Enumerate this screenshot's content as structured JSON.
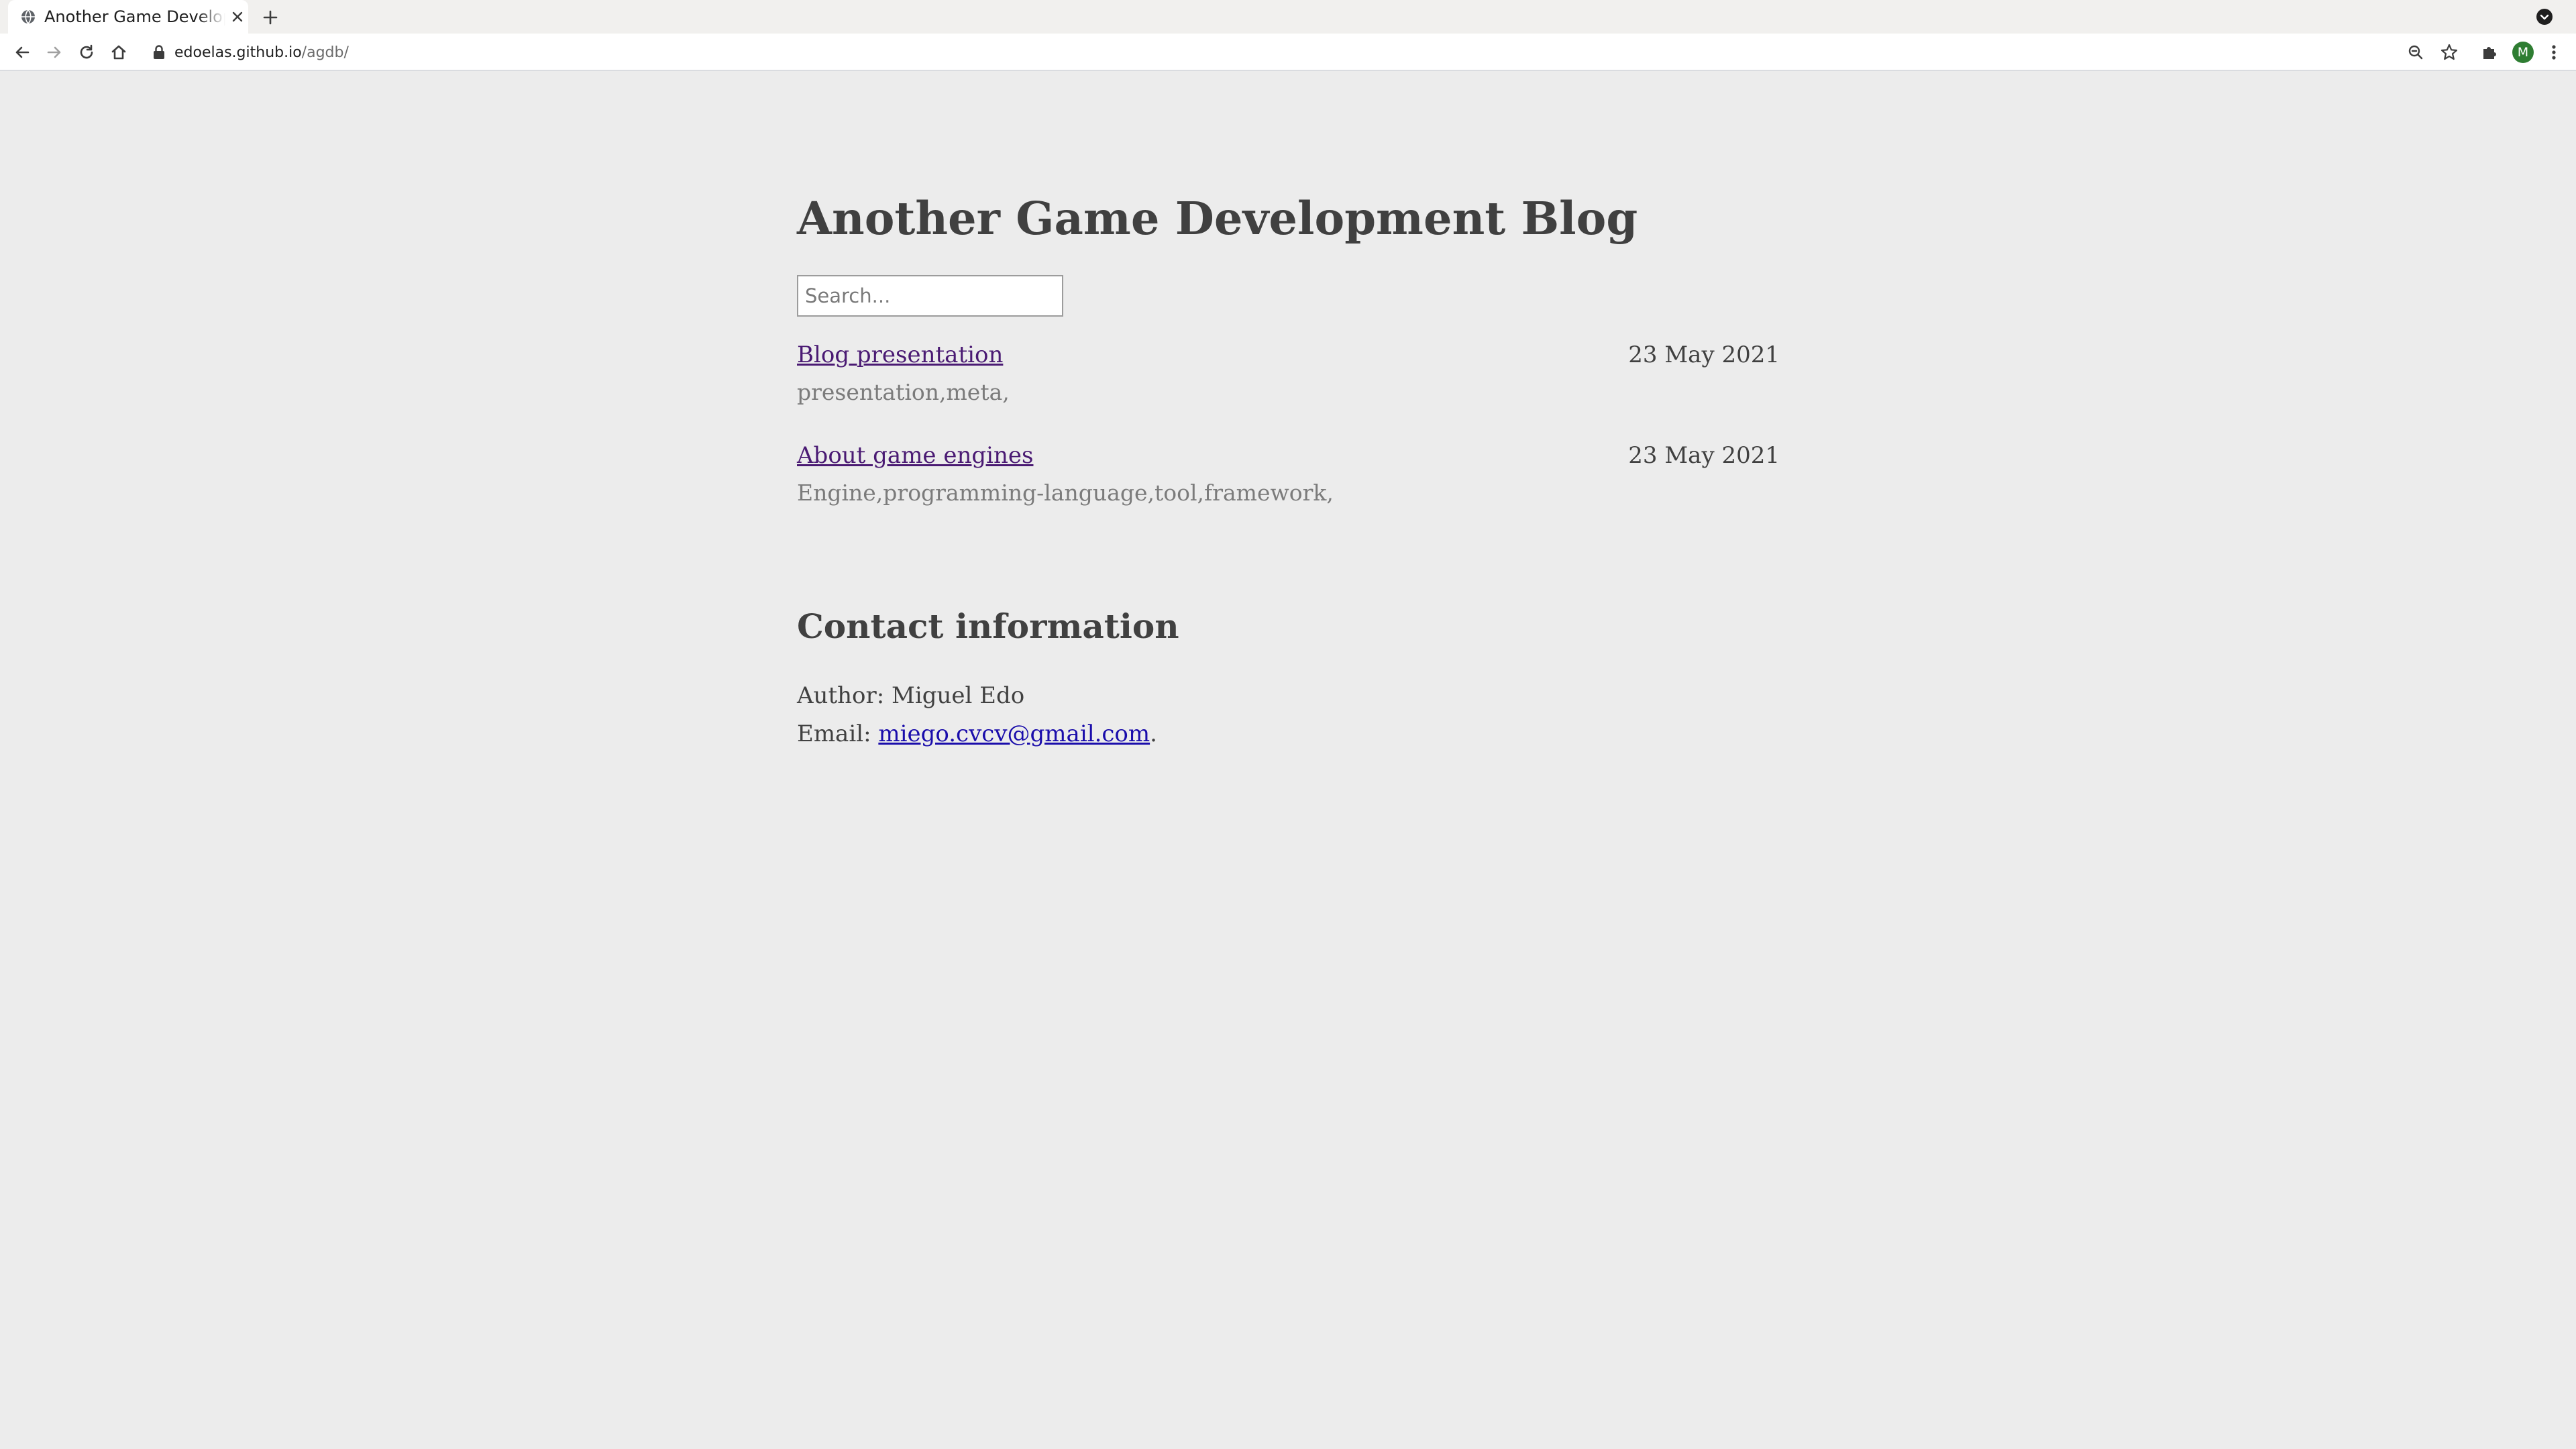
{
  "browser": {
    "tab": {
      "title": "Another Game Development Blog"
    },
    "address_bar": {
      "host": "edoelas.github.io",
      "path": "/agdb/"
    },
    "profile_initial": "M",
    "icons": {
      "favicon": "globe-icon",
      "tab_close": "close-icon",
      "new_tab": "plus-icon",
      "tab_search": "chevron-down-circle-icon",
      "back": "arrow-left-icon",
      "forward": "arrow-right-icon",
      "reload": "reload-icon",
      "home": "home-icon",
      "lock": "lock-icon",
      "zoom": "zoom-icon",
      "bookmark": "star-icon",
      "extensions": "puzzle-icon",
      "menu": "kebab-menu-icon"
    },
    "colors": {
      "avatar": "#2e7d32"
    }
  },
  "page": {
    "title": "Another Game Development Blog",
    "search": {
      "placeholder": "Search...",
      "value": ""
    },
    "posts": [
      {
        "title": "Blog presentation",
        "date": "23 May 2021",
        "tags": "presentation,meta,"
      },
      {
        "title": "About game engines",
        "date": "23 May 2021",
        "tags": "Engine,programming-language,tool,framework,"
      }
    ],
    "contact": {
      "heading": "Contact information",
      "author_label": "Author:",
      "author_name": "Miguel Edo",
      "email_label": "Email:",
      "email": "miego.cvcv@gmail.com",
      "email_suffix": "."
    },
    "colors": {
      "background": "#ececec",
      "text": "#404040",
      "visited_link": "#4a1a73",
      "link": "#1a0dab",
      "tags": "#7b7b7b"
    }
  }
}
